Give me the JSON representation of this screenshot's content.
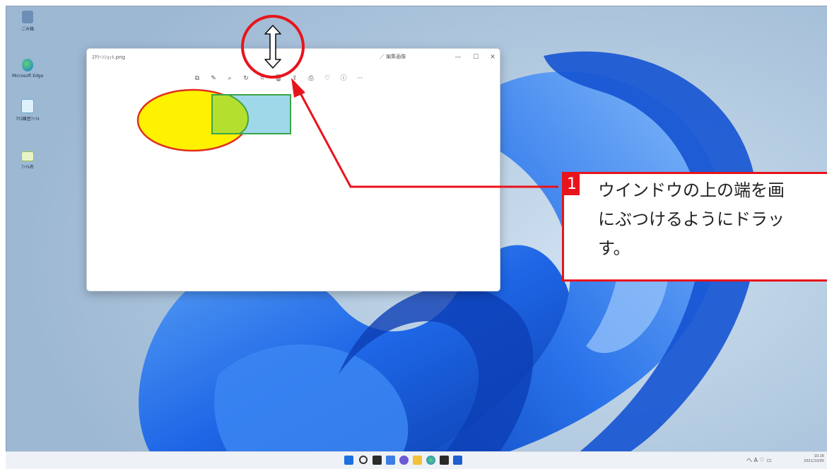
{
  "window": {
    "title": "ｽｸﾘｰﾝｼｮｯﾄ.png",
    "favorite_label": "／ 編集画像",
    "minimize": "—",
    "maximize": "☐",
    "close": "✕"
  },
  "toolbar": {
    "buttons": [
      "copy",
      "edit",
      "zoom",
      "rotate",
      "crop",
      "delete",
      "share",
      "print",
      "favorite",
      "info",
      "more"
    ],
    "more_label": "···"
  },
  "desktop_icons": [
    {
      "name": "recycle-bin-icon",
      "label": "ごみ箱",
      "color": "#6d8fb5"
    },
    {
      "name": "edge-icon",
      "label": "Microsoft Edge",
      "color": "#2a9e6a"
    },
    {
      "name": "mouse-file-icon",
      "label": "ﾏｳｽ練習ﾌｧｲﾙ",
      "color": "#9fd1ef"
    },
    {
      "name": "image-file-icon",
      "label": "ﾌｧｲﾙ名",
      "color": "#cfe6a0"
    }
  ],
  "callout": {
    "number": "1",
    "text": "ウインドウの上の端を画\nにぶつけるようにドラッ\nす。",
    "color": "#e8141b"
  },
  "taskbar": {
    "tray_text": "へ A ♡ ▭",
    "clock_time": "10:16",
    "clock_date": "2021/10/05"
  },
  "colors": {
    "ellipse_fill": "#fff200",
    "ellipse_stroke": "#e0301e",
    "rect_fill": "#9fd8e8",
    "rect_stroke": "#3aa54a",
    "overlap": "#b5df2e",
    "accent_blue": "#1763e0"
  }
}
